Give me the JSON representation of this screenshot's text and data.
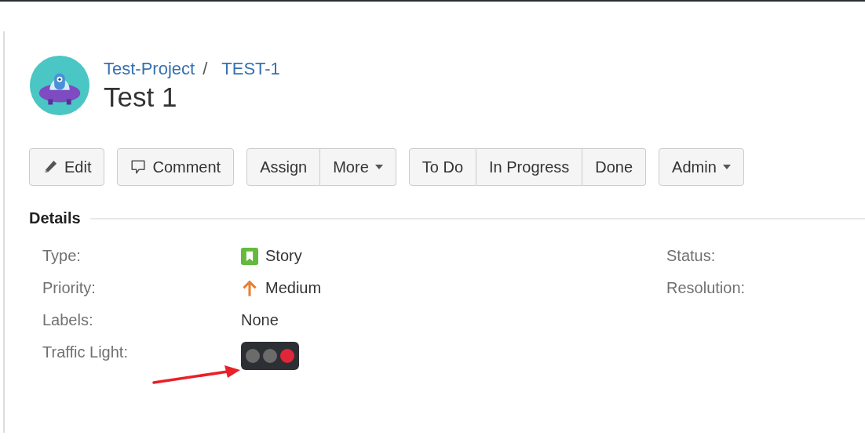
{
  "breadcrumb": {
    "project": "Test-Project",
    "separator": "/",
    "issue_key": "TEST-1"
  },
  "title": "Test 1",
  "toolbar": [
    {
      "buttons": [
        {
          "label": "Edit",
          "kind": "edit"
        }
      ]
    },
    {
      "buttons": [
        {
          "label": "Comment",
          "kind": "comment"
        }
      ]
    },
    {
      "buttons": [
        {
          "label": "Assign",
          "kind": "plain"
        },
        {
          "label": "More",
          "kind": "menu"
        }
      ]
    },
    {
      "buttons": [
        {
          "label": "To Do",
          "kind": "plain"
        },
        {
          "label": "In Progress",
          "kind": "plain"
        },
        {
          "label": "Done",
          "kind": "plain"
        }
      ]
    },
    {
      "buttons": [
        {
          "label": "Admin",
          "kind": "menu"
        }
      ]
    }
  ],
  "details": {
    "heading": "Details",
    "left_fields": [
      {
        "label": "Type:",
        "kind": "issue-type",
        "value": "Story"
      },
      {
        "label": "Priority:",
        "kind": "priority",
        "value": "Medium"
      },
      {
        "label": "Labels:",
        "kind": "text",
        "value": "None"
      },
      {
        "label": "Traffic Light:",
        "kind": "traffic-light",
        "lights": [
          {
            "color": "#6b6b6b"
          },
          {
            "color": "#6b6b6b"
          },
          {
            "color": "#e0273a"
          }
        ]
      }
    ],
    "right_fields": [
      {
        "label": "Status:"
      },
      {
        "label": "Resolution:"
      }
    ]
  }
}
